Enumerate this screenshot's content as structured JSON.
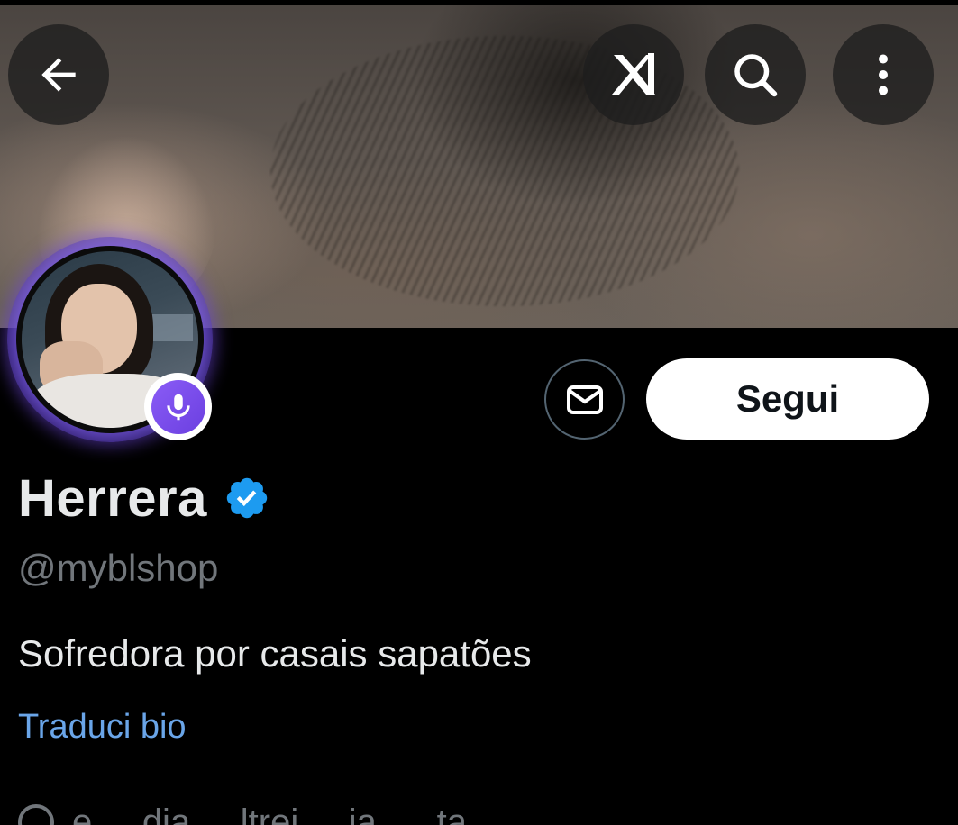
{
  "header": {
    "back_icon": "arrow-left-icon",
    "grok_icon": "grok-icon",
    "search_icon": "search-icon",
    "more_icon": "more-vertical-icon"
  },
  "profile": {
    "display_name": "Herrera",
    "verified": true,
    "handle": "@myblshop",
    "bio": "Sofredora por casais sapatões",
    "translate_label": "Traduci bio",
    "partial_line": "e ... dia ... ltrei ... ia .... ta"
  },
  "actions": {
    "message_icon": "envelope-icon",
    "follow_label": "Segui"
  },
  "colors": {
    "verified_blue": "#1d9bf0",
    "link_blue": "#6aa5e8",
    "avatar_ring": "#7c4dff",
    "muted": "#71767b"
  }
}
